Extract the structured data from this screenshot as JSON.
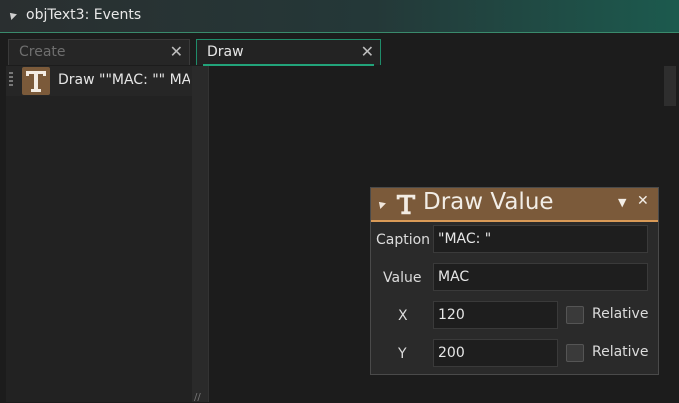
{
  "window": {
    "title": "objText3: Events"
  },
  "tabs": [
    {
      "label": "Create",
      "state": "inactive"
    },
    {
      "label": "Draw",
      "state": "active"
    }
  ],
  "events": [
    {
      "icon": "text-t-icon",
      "label": "Draw \"\"MAC: \"\" MA"
    }
  ],
  "action": {
    "title": "Draw Value",
    "fields": {
      "caption": {
        "label": "Caption",
        "value": "\"MAC: \""
      },
      "value": {
        "label": "Value",
        "value": "MAC"
      },
      "x": {
        "label": "X",
        "value": "120",
        "relative_label": "Relative",
        "relative": false
      },
      "y": {
        "label": "Y",
        "value": "200",
        "relative_label": "Relative",
        "relative": false
      }
    }
  },
  "colors": {
    "accent": "#22a37a",
    "action_brown": "#7b5a3a",
    "action_border": "#d99a57"
  }
}
